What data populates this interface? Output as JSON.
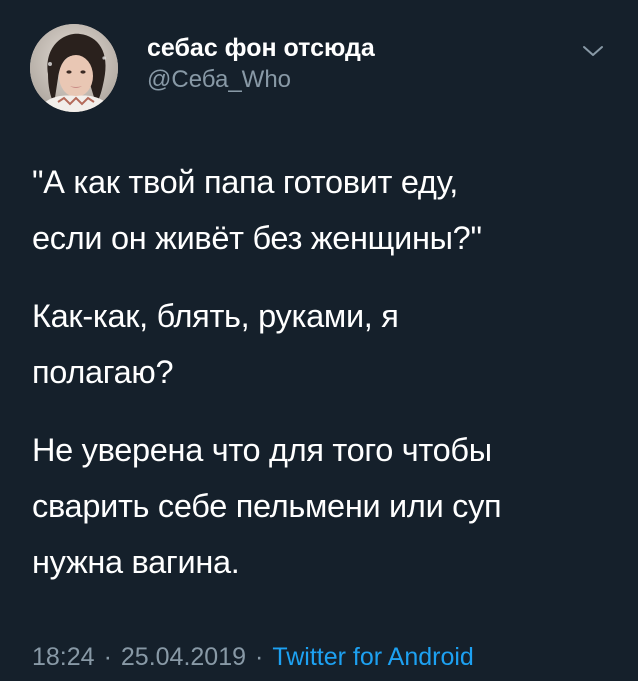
{
  "author": {
    "display_name": "себас фон отсюда",
    "handle": "@Себа_Who"
  },
  "icons": {
    "menu": "chevron-down-icon",
    "avatar": "profile-photo"
  },
  "tweet": {
    "paragraphs": [
      "\"А как твой папа готовит еду,\nесли он живёт без женщины?\"",
      "Как-как, блять, руками, я\nполагаю?",
      "Не уверена что для того чтобы\nсварить себе пельмени или суп\nнужна вагина."
    ],
    "time": "18:24",
    "date": "25.04.2019",
    "separator": "·",
    "source": "Twitter for Android"
  },
  "colors": {
    "background": "#15202b",
    "text": "#ffffff",
    "secondary_text": "#8899a6",
    "link": "#1da1f2"
  }
}
